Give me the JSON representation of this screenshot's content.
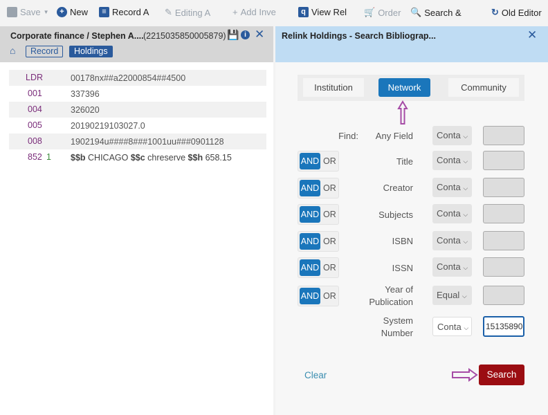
{
  "toolbar": {
    "save": "Save",
    "new": "New",
    "record_actions": "Record A",
    "editing_actions": "Editing A",
    "add_inventory": "Add Inve",
    "view_related": "View Rel",
    "order": "Order",
    "search": "Search &",
    "old_editor": "Old Editor"
  },
  "left_panel": {
    "title": "Corporate finance / Stephen A....",
    "record_id": "(2215035850005879)",
    "record_tab": "Record",
    "holdings_tab": "Holdings",
    "fields": [
      {
        "tag": "LDR",
        "ind": "",
        "value": "00178nx##a22000854##4500"
      },
      {
        "tag": "001",
        "ind": "",
        "value": "337396"
      },
      {
        "tag": "004",
        "ind": "",
        "value": "326020"
      },
      {
        "tag": "005",
        "ind": "",
        "value": "20190219103027.0"
      },
      {
        "tag": "008",
        "ind": "",
        "value": "1902194u####8###1001uu###0901128"
      },
      {
        "tag": "852",
        "ind": "1",
        "sub1": "$$b",
        "v1": " CHICAGO ",
        "sub2": "$$c",
        "v2": " chreserve ",
        "sub3": "$$h",
        "v3": " 658.15"
      }
    ]
  },
  "right_panel": {
    "title": "Relink Holdings - Search Bibliograp...",
    "tabs": [
      "Institution",
      "Network",
      "Community"
    ],
    "active_tab": "Network",
    "find_label": "Find:",
    "and": "AND",
    "or": "OR",
    "rows": [
      {
        "label": "Any Field",
        "op": "Conta",
        "value": ""
      },
      {
        "label": "Title",
        "op": "Conta",
        "value": ""
      },
      {
        "label": "Creator",
        "op": "Conta",
        "value": ""
      },
      {
        "label": "Subjects",
        "op": "Conta",
        "value": ""
      },
      {
        "label": "ISBN",
        "op": "Conta",
        "value": ""
      },
      {
        "label": "ISSN",
        "op": "Conta",
        "value": ""
      },
      {
        "label": "Year of Publication",
        "op": "Equal",
        "value": ""
      },
      {
        "label": "System Number",
        "op": "Conta",
        "value": "15135890"
      }
    ],
    "clear": "Clear",
    "search": "Search"
  },
  "colors": {
    "accent": "#1a76bb",
    "search_button": "#9b0d12",
    "annotation_arrow": "#a64ca6"
  }
}
